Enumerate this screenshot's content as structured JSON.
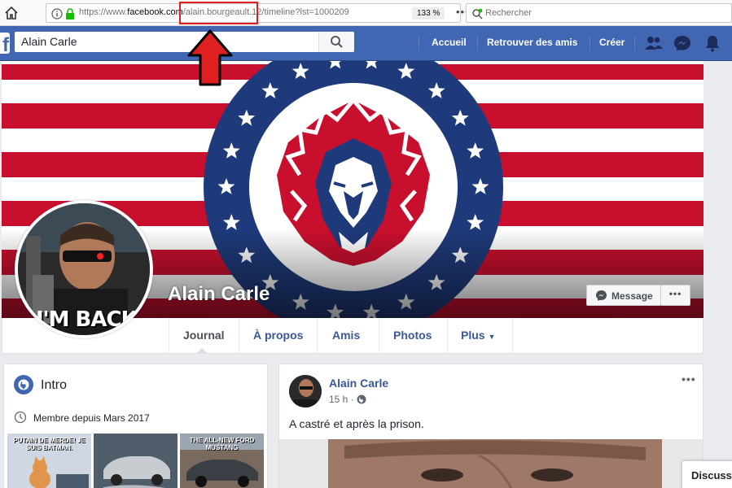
{
  "browser": {
    "url_prefix": "https://www.",
    "url_domain": "facebook.com",
    "url_path": "/alain.bourgeault.12/timeline?lst=1000209",
    "zoom": "133 %",
    "search_placeholder": "Rechercher"
  },
  "fbnav": {
    "search_value": "Alain Carle",
    "links": [
      "Accueil",
      "Retrouver des amis",
      "Créer"
    ]
  },
  "profile": {
    "name": "Alain Carle",
    "avatar_caption": "I'M BACK",
    "message_label": "Message",
    "more_label": "•••"
  },
  "tabs": [
    "Journal",
    "À propos",
    "Amis",
    "Photos",
    "Plus"
  ],
  "intro": {
    "title": "Intro",
    "member_since": "Membre depuis Mars 2017",
    "photo_captions": [
      "PUTAIN DE MERDE! JE SUIS BATMAN.",
      "",
      "THE ALL-NEW FORD MUSTANG"
    ]
  },
  "post": {
    "author": "Alain Carle",
    "time": "15 h ·",
    "menu": "•••",
    "text": "A castré et après la prison."
  },
  "chat": {
    "label": "Discuss"
  },
  "colors": {
    "fb_blue": "#4267b2",
    "link_blue": "#385898",
    "flag_red": "#c8102e",
    "flag_navy": "#1f3a7a",
    "annotation_red": "#e02020"
  }
}
